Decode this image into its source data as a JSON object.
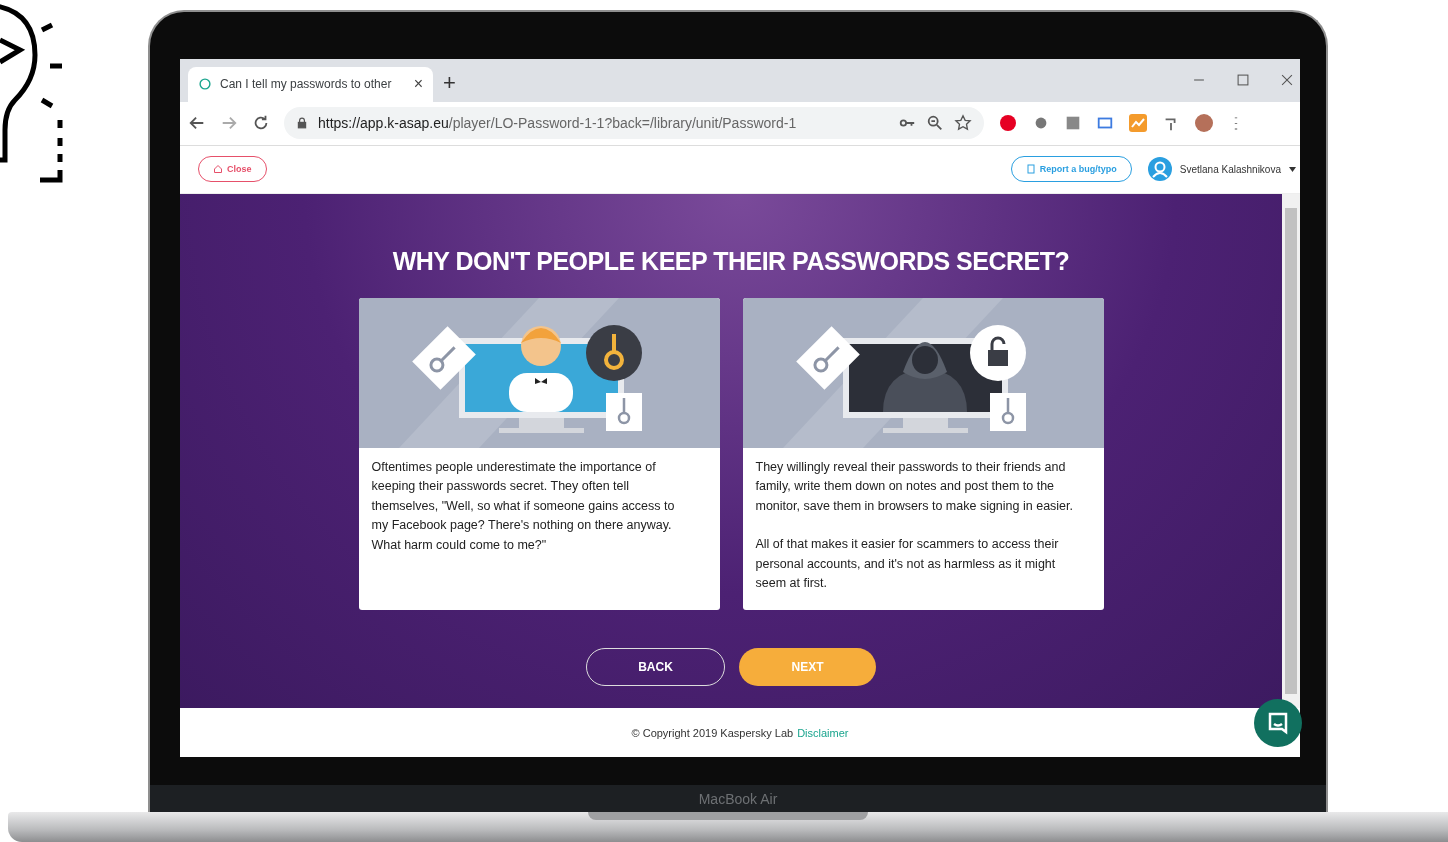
{
  "browser": {
    "tab": {
      "title": "Can I tell my passwords to other",
      "close": "×"
    },
    "new_tab": "+",
    "url": {
      "host": "https://app.k-asap.eu",
      "path": "/player/LO-Password-1-1?back=/library/unit/Password-1"
    }
  },
  "header": {
    "close_button": "Close",
    "report_button": "Report a bug/typo",
    "user": "Svetlana Kalashnikova"
  },
  "heading": "WHY DON'T PEOPLE KEEP THEIR PASSWORDS SECRET?",
  "cards": [
    {
      "kind": "person",
      "paragraphs": [
        "Oftentimes people underestimate the importance of keeping their passwords secret. They often tell themselves, \"Well, so what if someone gains access to my Facebook page? There's nothing on there anyway. What harm could come to me?\""
      ]
    },
    {
      "kind": "hooded",
      "paragraphs": [
        "They willingly reveal their passwords to their friends and family, write them down on notes and post them to the monitor, save them in browsers to make signing in easier.",
        "All of that makes it easier for scammers to access their personal accounts, and it's not as harmless as it might seem at first."
      ]
    }
  ],
  "buttons": [
    {
      "label": "BACK",
      "kind": "outline"
    },
    {
      "label": "NEXT",
      "kind": "filled"
    }
  ],
  "footer": {
    "copyright": "© Copyright 2019 Kaspersky Lab",
    "link": "Disclaimer"
  },
  "laptop_label": "MacBook Air"
}
